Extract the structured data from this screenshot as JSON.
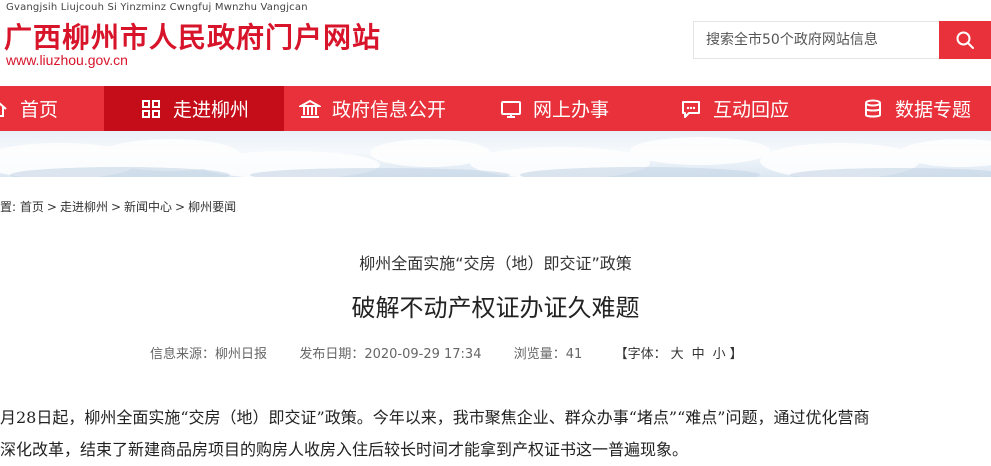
{
  "header": {
    "subtitle": "Gvangjsih Liujcouh Si Yinzminz Cwngfuj Mwnzhu Vangjcan",
    "title": "广西柳州市人民政府门户网站",
    "url": "www.liuzhou.gov.cn"
  },
  "search": {
    "placeholder": "搜索全市50个政府网站信息",
    "icon": "search-icon"
  },
  "nav": {
    "items": [
      {
        "label": "首页",
        "icon": "home-icon"
      },
      {
        "label": "走进柳州",
        "icon": "grid-icon"
      },
      {
        "label": "政府信息公开",
        "icon": "building-icon"
      },
      {
        "label": "网上办事",
        "icon": "monitor-icon"
      },
      {
        "label": "互动回应",
        "icon": "chat-icon"
      },
      {
        "label": "数据专题",
        "icon": "database-icon"
      }
    ]
  },
  "breadcrumb": {
    "prefix": "置:",
    "items": [
      "首页",
      "走进柳州",
      "新闻中心",
      "柳州要闻"
    ]
  },
  "article": {
    "kicker": "柳州全面实施“交房（地）即交证”政策",
    "headline": "破解不动产权证办证久难题",
    "source_label": "信息来源：",
    "source": "柳州日报",
    "date_label": "发布日期：",
    "date": "2020-09-29 17:34",
    "views_label": "浏览量：",
    "views": "41",
    "fontsize_label": "【字体：",
    "fontsize_options": [
      "大",
      "中",
      "小"
    ],
    "fontsize_close": "】",
    "body": [
      "月28日起，柳州全面实施“交房（地）即交证”政策。今年以来，我市聚焦企业、群众办事“堵点”“难点”问题，通过优化营商",
      "深化改革，结束了新建商品房项目的购房人收房入住后较长时间才能拿到产权证书这一普遍现象。"
    ]
  },
  "colors": {
    "brand_red": "#d7142a",
    "nav_red": "#e8313a",
    "nav_active": "#c40d18"
  }
}
